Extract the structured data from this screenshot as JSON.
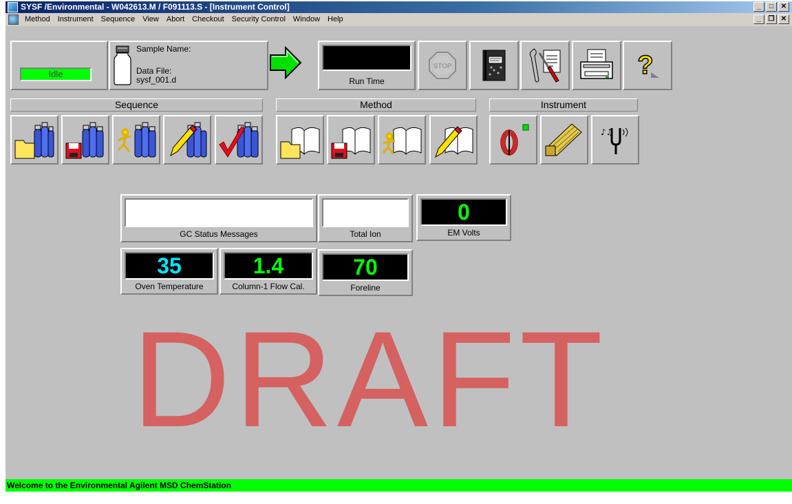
{
  "window": {
    "title": "SYSF /Environmental - W042613.M / F091113.S - [Instrument Control]",
    "minimize_glyph": "_",
    "maximize_glyph": "□",
    "restore_glyph": "❐",
    "close_glyph": "✕"
  },
  "menu": {
    "items": [
      {
        "label": "Method"
      },
      {
        "label": "Instrument"
      },
      {
        "label": "Sequence"
      },
      {
        "label": "View"
      },
      {
        "label": "Abort"
      },
      {
        "label": "Checkout"
      },
      {
        "label": "Security Control"
      },
      {
        "label": "Window"
      },
      {
        "label": "Help"
      }
    ]
  },
  "toolbar": {
    "status": "Idle",
    "status_color": "#00ff00",
    "sample_name_label": "Sample Name:",
    "sample_name_value": "",
    "data_file_label": "Data File:",
    "data_file_value": "sysf_001.d",
    "run_time_label": "Run Time",
    "run_time_value": "",
    "start_icon": "green-arrow-icon",
    "stop_icon": "stop-sign-icon",
    "logbook_icon": "notebook-icon",
    "tools_icon": "wrench-screwdriver-icon",
    "print_icon": "printer-icon",
    "help_icon": "question-mark-icon"
  },
  "groups": {
    "sequence": "Sequence",
    "method": "Method",
    "instrument": "Instrument"
  },
  "sequence_buttons": [
    "load-sequence-icon",
    "save-sequence-icon",
    "run-sequence-icon",
    "edit-sequence-icon",
    "check-sequence-icon"
  ],
  "method_buttons": [
    "load-method-icon",
    "save-method-icon",
    "run-method-icon",
    "edit-method-icon"
  ],
  "instrument_buttons": [
    "column-icon",
    "ion-source-icon",
    "tune-icon"
  ],
  "monitors": {
    "gc_status_label": "GC Status Messages",
    "gc_status_value": "",
    "total_ion_label": "Total Ion",
    "total_ion_value": "",
    "em_volts_label": "EM Volts",
    "em_volts_value": "0",
    "oven_temp_label": "Oven Temperature",
    "oven_temp_value": "35",
    "column_flow_label": "Column-1 Flow Cal.",
    "column_flow_value": "1.4",
    "foreline_label": "Foreline",
    "foreline_value": "70"
  },
  "watermark": "DRAFT",
  "status_bar": {
    "text": "Welcome to the Environmental Agilent MSD ChemStation",
    "color": "#00ff00"
  }
}
